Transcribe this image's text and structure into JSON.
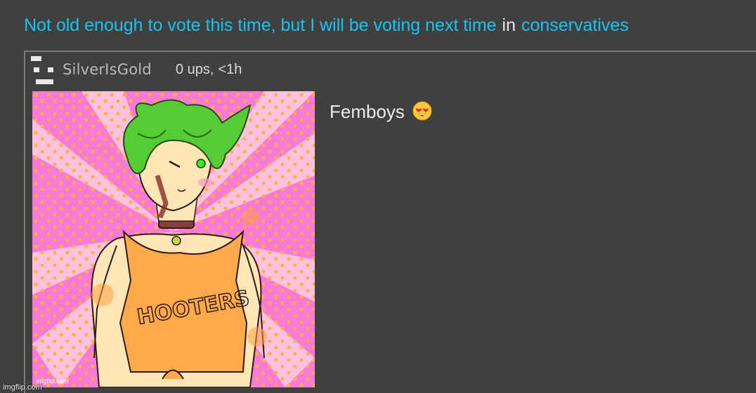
{
  "post": {
    "title": "Not old enough to vote this time, but I will be voting next time",
    "in_word": "in",
    "stream": "conservatives"
  },
  "comment": {
    "username": "SilverIsGold",
    "ups": "0 ups,",
    "age": "<1h",
    "text": "Femboys",
    "emoji_icon": "heart-eyes-emoji-icon",
    "image_watermark": "imgflip.com",
    "image_shirt_text": "HOOTERS"
  },
  "site_watermark": "imgflip.com",
  "colors": {
    "background": "#404040",
    "link": "#19c3f0",
    "border": "#7b7b7b",
    "username": "#b9b9b9",
    "text": "#ececec"
  }
}
